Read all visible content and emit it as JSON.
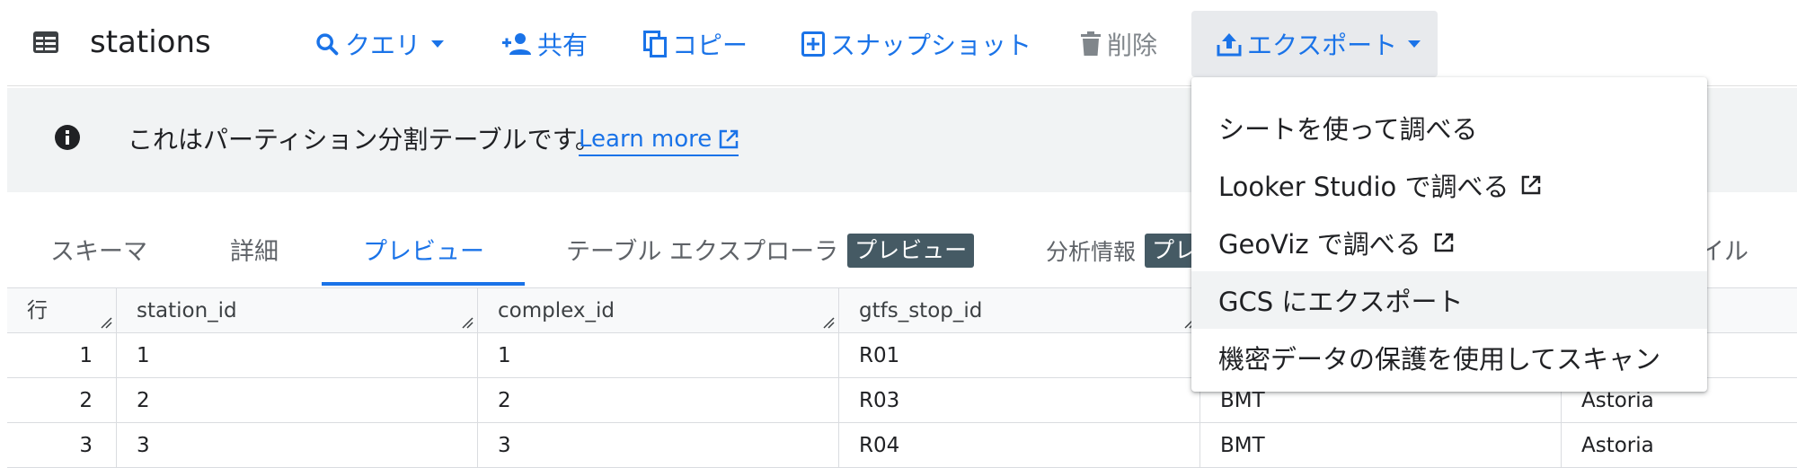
{
  "toolbar": {
    "title": "stations",
    "query_label": "クエリ",
    "share_label": "共有",
    "copy_label": "コピー",
    "snapshot_label": "スナップショット",
    "delete_label": "削除",
    "export_label": "エクスポート",
    "accent_color": "#1a73e8"
  },
  "banner": {
    "text": "これはパーティション分割テーブルです。",
    "link_label": "Learn more"
  },
  "tabs": [
    {
      "label": "スキーマ"
    },
    {
      "label": "詳細"
    },
    {
      "label": "プレビュー"
    },
    {
      "label": "テーブル エクスプローラ",
      "badge": "プレビュー"
    },
    {
      "label": "分析情報",
      "badge": "プレ"
    },
    {
      "label": "イル"
    }
  ],
  "table": {
    "headers": [
      "行",
      "station_id",
      "complex_id",
      "gtfs_stop_id"
    ],
    "rows": [
      {
        "row": "1",
        "station_id": "1",
        "complex_id": "1",
        "gtfs_stop_id": "R01",
        "division": "",
        "line": ""
      },
      {
        "row": "2",
        "station_id": "2",
        "complex_id": "2",
        "gtfs_stop_id": "R03",
        "division": "BMT",
        "line": "Astoria"
      },
      {
        "row": "3",
        "station_id": "3",
        "complex_id": "3",
        "gtfs_stop_id": "R04",
        "division": "BMT",
        "line": "Astoria"
      }
    ]
  },
  "export_menu": {
    "items": [
      {
        "label": "シートを使って調べる",
        "external": false
      },
      {
        "label": "Looker Studio で調べる",
        "external": true
      },
      {
        "label": "GeoViz で調べる",
        "external": true
      },
      {
        "label": "GCS にエクスポート",
        "external": false
      },
      {
        "label": "機密データの保護を使用してスキャン",
        "external": false
      }
    ]
  }
}
